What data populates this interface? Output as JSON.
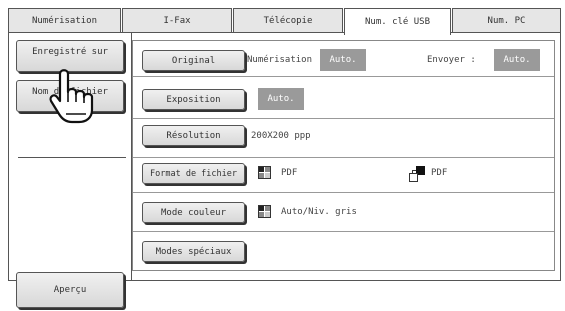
{
  "tabs": [
    "Numérisation",
    "I-Fax",
    "Télécopie",
    "Num. clé USB",
    "Num. PC"
  ],
  "active_tab_index": 3,
  "left": {
    "saved_button": "Enregistré sur",
    "filename_button": "Nom de fichier",
    "preview_button": "Aperçu"
  },
  "settings": {
    "original": {
      "button": "Original",
      "scan_label": "Numérisation",
      "scan_value": "Auto.",
      "send_label": "Envoyer :",
      "send_value": "Auto."
    },
    "exposure": {
      "button": "Exposition",
      "value": "Auto."
    },
    "resolution": {
      "button": "Résolution",
      "value": "200X200 ppp"
    },
    "file_format": {
      "button": "Format de fichier",
      "value1": "PDF",
      "value2": "PDF"
    },
    "color_mode": {
      "button": "Mode couleur",
      "value": "Auto/Niv. gris"
    },
    "special_modes": {
      "button": "Modes spéciaux"
    }
  },
  "icons": {
    "pointer": "hand-pointer-icon",
    "format_color": "color-grid-icon",
    "format_compact": "compact-pdf-icon",
    "color_mode": "color-grid-icon"
  }
}
